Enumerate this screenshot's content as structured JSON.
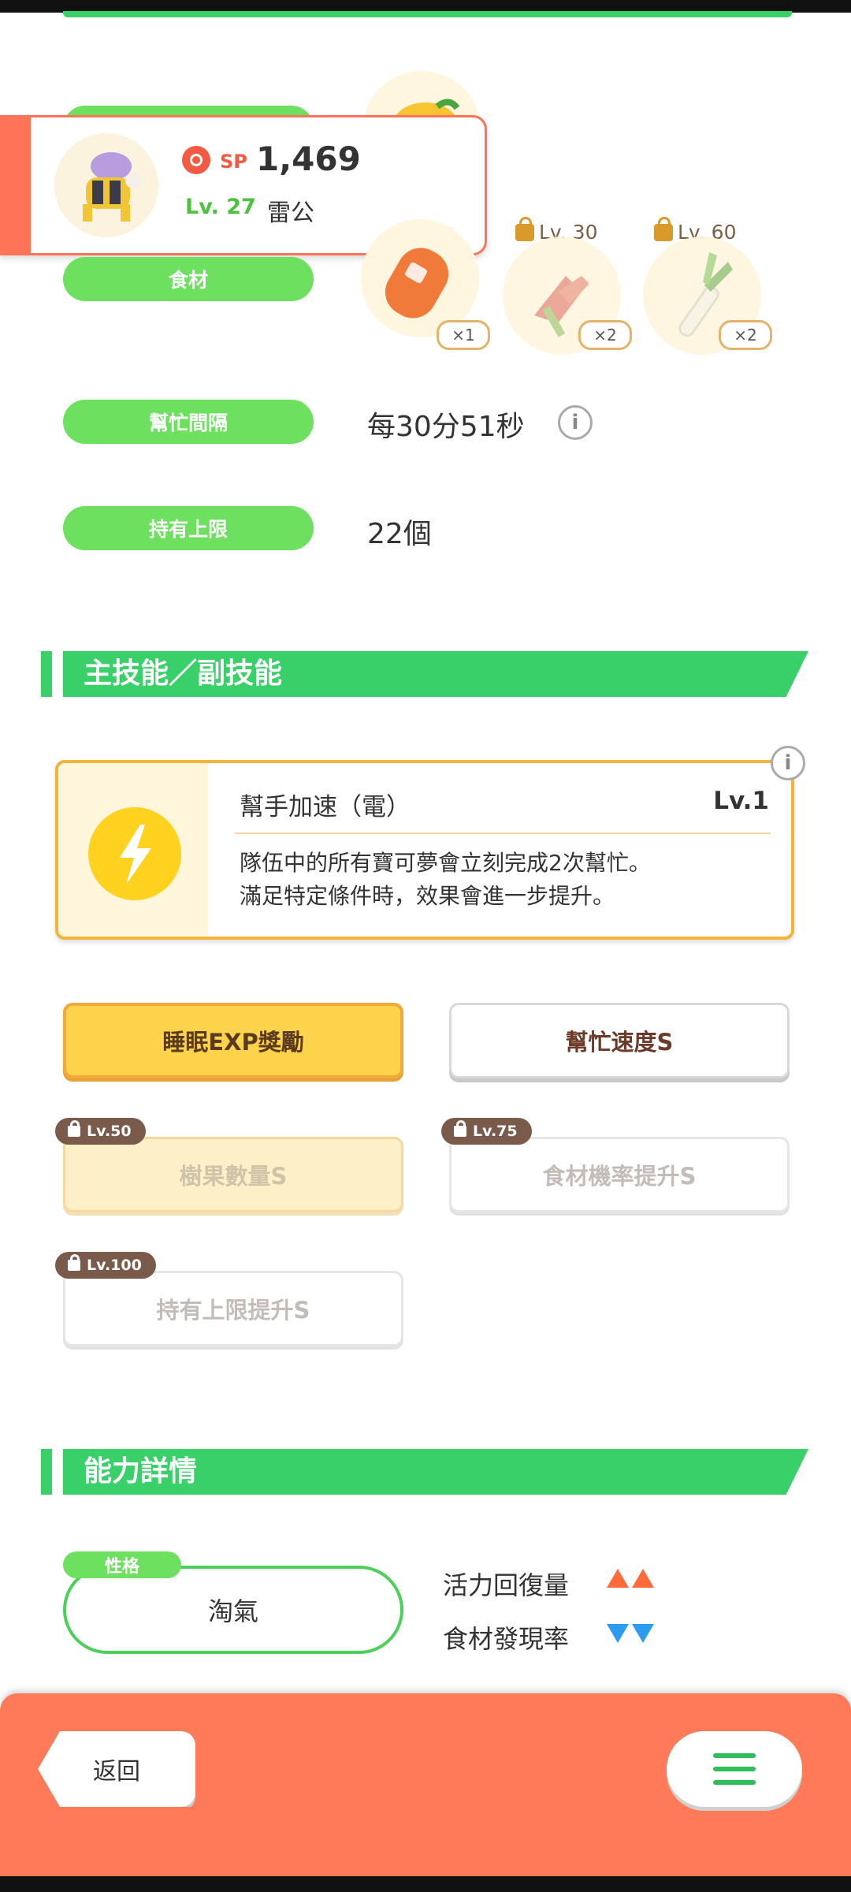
{
  "pokemon": {
    "sp_label": "SP",
    "sp_value": "1,469",
    "level": "Lv. 27",
    "name": "雷公"
  },
  "ingredients": {
    "label": "食材",
    "items": [
      {
        "icon": "sausage-icon",
        "qty": "×1",
        "unlock": ""
      },
      {
        "icon": "ginger-icon",
        "qty": "×2",
        "unlock": "Lv. 30"
      },
      {
        "icon": "leek-icon",
        "qty": "×2",
        "unlock": "Lv. 60"
      }
    ]
  },
  "help_interval": {
    "label": "幫忙間隔",
    "value": "每30分51秒"
  },
  "carry_limit": {
    "label": "持有上限",
    "value": "22個"
  },
  "skills_section": {
    "title": "主技能／副技能"
  },
  "main_skill": {
    "name": "幫手加速（電）",
    "level": "Lv.1",
    "desc_line1": "隊伍中的所有寶可夢會立刻完成2次幫忙。",
    "desc_line2": "滿足特定條件時，效果會進一步提升。"
  },
  "sub_skills": [
    {
      "label": "睡眠EXP獎勵",
      "unlock": ""
    },
    {
      "label": "幫忙速度S",
      "unlock": ""
    },
    {
      "label": "樹果數量S",
      "unlock": "Lv.50"
    },
    {
      "label": "食材機率提升S",
      "unlock": "Lv.75"
    },
    {
      "label": "持有上限提升S",
      "unlock": "Lv.100"
    }
  ],
  "ability_section": {
    "title": "能力詳情"
  },
  "nature": {
    "tag": "性格",
    "value": "淘氣",
    "up_label": "活力回復量",
    "down_label": "食材發現率"
  },
  "bottom": {
    "back_label": "返回"
  },
  "colors": {
    "accent_green": "#39d069",
    "bottom_orange": "#ff7a59",
    "skill_gold": "#f2b43a"
  }
}
